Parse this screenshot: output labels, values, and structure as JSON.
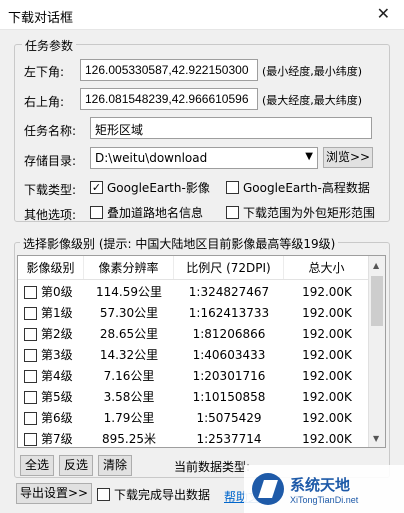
{
  "window": {
    "title": "下载对话框",
    "close_glyph": "✕"
  },
  "task_params": {
    "legend": "任务参数",
    "lower_left_label": "左下角:",
    "lower_left_value": "126.005330587,42.922150300",
    "lower_left_hint": "(最小经度,最小纬度)",
    "upper_right_label": "右上角:",
    "upper_right_value": "126.081548239,42.966610596",
    "upper_right_hint": "(最大经度,最大纬度)",
    "task_name_label": "任务名称:",
    "task_name_value": "矩形区域",
    "storage_label": "存储目录:",
    "storage_value": "D:\\weitu\\download",
    "browse_button": "浏览>>",
    "download_type_label": "下载类型:",
    "type_imagery": {
      "label": "GoogleEarth-影像",
      "checked": true
    },
    "type_elevation": {
      "label": "GoogleEarth-高程数据",
      "checked": false
    },
    "other_options_label": "其他选项:",
    "opt_overlay_roads": {
      "label": "叠加道路地名信息",
      "checked": false
    },
    "opt_outer_rect": {
      "label": "下载范围为外包矩形范围",
      "checked": false
    }
  },
  "levels": {
    "legend": "选择影像级别 (提示: 中国大陆地区目前影像最高等级19级)",
    "columns": [
      "影像级别",
      "像素分辨率",
      "比例尺 (72DPI)",
      "总大小"
    ],
    "rows": [
      {
        "level": "第0级",
        "resolution": "114.59公里",
        "scale": "1:324827467",
        "size": "192.00K"
      },
      {
        "level": "第1级",
        "resolution": "57.30公里",
        "scale": "1:162413733",
        "size": "192.00K"
      },
      {
        "level": "第2级",
        "resolution": "28.65公里",
        "scale": "1:81206866",
        "size": "192.00K"
      },
      {
        "level": "第3级",
        "resolution": "14.32公里",
        "scale": "1:40603433",
        "size": "192.00K"
      },
      {
        "level": "第4级",
        "resolution": "7.16公里",
        "scale": "1:20301716",
        "size": "192.00K"
      },
      {
        "level": "第5级",
        "resolution": "3.58公里",
        "scale": "1:10150858",
        "size": "192.00K"
      },
      {
        "level": "第6级",
        "resolution": "1.79公里",
        "scale": "1:5075429",
        "size": "192.00K"
      },
      {
        "level": "第7级",
        "resolution": "895.25米",
        "scale": "1:2537714",
        "size": "192.00K"
      }
    ],
    "select_all": "全选",
    "invert": "反选",
    "clear": "清除",
    "current_type_label": "当前数据类型:"
  },
  "footer": {
    "export_settings": "导出设置>>",
    "export_after_download": {
      "label": "下载完成导出数据",
      "checked": false
    },
    "help_link": "帮助文档"
  },
  "watermark": {
    "cn": "系统天地",
    "en": "XiTongTianDi.net"
  },
  "colors": {
    "accent": "#0066cc",
    "watermark": "#1e5aa8"
  }
}
